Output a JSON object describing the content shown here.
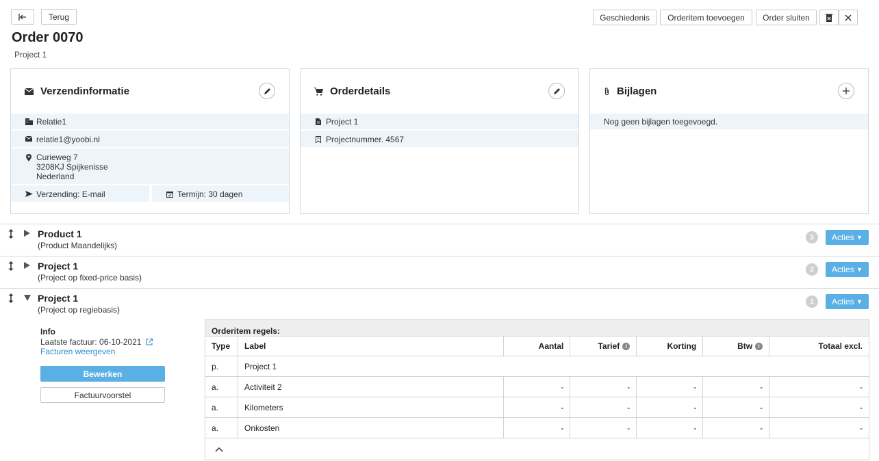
{
  "header": {
    "back_label": "Terug",
    "history_label": "Geschiedenis",
    "add_item_label": "Orderitem toevoegen",
    "close_order_label": "Order sluiten",
    "title": "Order 0070",
    "subtitle": "Project 1"
  },
  "cards": {
    "shipping": {
      "title": "Verzendinformatie",
      "relation": "Relatie1",
      "email": "relatie1@yoobi.nl",
      "address_line1": "Curieweg 7",
      "address_line2": "3208KJ Spijkenisse",
      "address_line3": "Nederland",
      "shipping_method": "Verzending: E-mail",
      "term": "Termijn: 30 dagen"
    },
    "order_details": {
      "title": "Orderdetails",
      "project": "Project 1",
      "project_number": "Projectnummer. 4567"
    },
    "attachments": {
      "title": "Bijlagen",
      "empty_text": "Nog geen bijlagen toegevoegd."
    }
  },
  "items": [
    {
      "title": "Product 1",
      "subtitle": "(Product Maandelijks)",
      "count": "3",
      "actions_label": "Acties"
    },
    {
      "title": "Project 1",
      "subtitle": "(Project op fixed-price basis)",
      "count": "2",
      "actions_label": "Acties"
    },
    {
      "title": "Project 1",
      "subtitle": "(Project op regiebasis)",
      "count": "1",
      "actions_label": "Acties"
    }
  ],
  "expanded": {
    "info_title": "Info",
    "last_invoice": "Laatste factuur: 06-10-2021",
    "view_invoices": "Facturen weergeven",
    "edit_label": "Bewerken",
    "invoice_proposal_label": "Factuurvoorstel"
  },
  "lines_table": {
    "caption": "Orderitem regels:",
    "headers": [
      "Type",
      "Label",
      "Aantal",
      "Tarief",
      "Korting",
      "Btw",
      "Totaal excl."
    ],
    "rows": [
      {
        "type": "p.",
        "label": "Project 1"
      },
      {
        "type": "a.",
        "label": "Activiteit 2",
        "aantal": "-",
        "tarief": "-",
        "korting": "-",
        "btw": "-",
        "totaal": "-"
      },
      {
        "type": "a.",
        "label": "Kilometers",
        "aantal": "-",
        "tarief": "-",
        "korting": "-",
        "btw": "-",
        "totaal": "-"
      },
      {
        "type": "a.",
        "label": "Onkosten",
        "aantal": "-",
        "tarief": "-",
        "korting": "-",
        "btw": "-",
        "totaal": "-"
      }
    ]
  },
  "colors": {
    "accent": "#5ab0e4",
    "row_background": "#eef5fa",
    "link": "#2d8ac9"
  }
}
